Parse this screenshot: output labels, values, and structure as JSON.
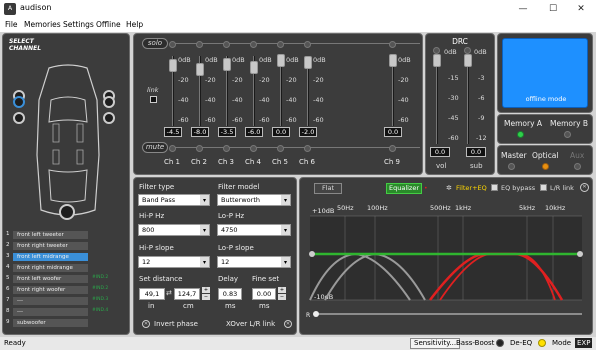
{
  "app": {
    "title": "audison",
    "logo": "A"
  },
  "window": {
    "minimize": "—",
    "maximize": "☐",
    "close": "✕"
  },
  "menu": [
    "File",
    "Memories",
    "Settings",
    "Offline",
    "Help"
  ],
  "select_channel": {
    "line1": "SELECT",
    "line2": "CHANNEL"
  },
  "channels": [
    {
      "num": "1",
      "name": "front left tweeter",
      "tag": "",
      "selected": false
    },
    {
      "num": "2",
      "name": "front right tweeter",
      "tag": "",
      "selected": false
    },
    {
      "num": "3",
      "name": "front left midrange",
      "tag": "",
      "selected": true
    },
    {
      "num": "4",
      "name": "front right midrange",
      "tag": "",
      "selected": false
    },
    {
      "num": "5",
      "name": "front left woofer",
      "tag": "#IND.2",
      "selected": false
    },
    {
      "num": "6",
      "name": "front right woofer",
      "tag": "#IND.2",
      "selected": false
    },
    {
      "num": "7",
      "name": "---",
      "tag": "#IND.3",
      "selected": false
    },
    {
      "num": "8",
      "name": "---",
      "tag": "#IND.4",
      "selected": false
    },
    {
      "num": "9",
      "name": "subwoofer",
      "tag": "",
      "selected": false
    }
  ],
  "mixer": {
    "solo": "solo",
    "mute": "mute",
    "link": "link",
    "scale": [
      "0dB",
      "-20",
      "-40",
      "-60"
    ],
    "faders": [
      {
        "label": "Ch 1",
        "value": "-4.5",
        "level": 0.075
      },
      {
        "label": "Ch 2",
        "value": "-8.0",
        "level": 0.133
      },
      {
        "label": "Ch 3",
        "value": "-3.5",
        "level": 0.058
      },
      {
        "label": "Ch 4",
        "value": "-6.0",
        "level": 0.1
      },
      {
        "label": "Ch 5",
        "value": "0.0",
        "level": 0.0
      },
      {
        "label": "Ch 6",
        "value": "-2.0",
        "level": 0.033
      },
      {
        "label": "Ch 9",
        "value": "0.0",
        "level": 0.0
      }
    ]
  },
  "drc": {
    "title": "DRC",
    "vol_label": "vol",
    "sub_label": "sub",
    "vol_scale": [
      "0dB",
      "-15",
      "-30",
      "-45",
      "-60"
    ],
    "sub_scale": [
      "0dB",
      "-3",
      "-6",
      "-9",
      "-12"
    ],
    "vol_value": "0.0",
    "sub_value": "0.0"
  },
  "offline_mode": "offline mode",
  "memory": {
    "a": "Memory A",
    "b": "Memory B"
  },
  "inputs": {
    "master": "Master",
    "optical": "Optical",
    "aux": "Aux"
  },
  "filter": {
    "type_label": "Filter type",
    "type_value": "Band Pass",
    "model_label": "Filter model",
    "model_value": "Butterworth",
    "hip_hz_label": "Hi-P Hz",
    "hip_hz_value": "800",
    "lop_hz_label": "Lo-P Hz",
    "lop_hz_value": "4750",
    "hip_slope_label": "Hi-P slope",
    "hip_slope_value": "12",
    "lop_slope_label": "Lo-P slope",
    "lop_slope_value": "12",
    "distance_label": "Set distance",
    "distance_in": "49,1",
    "distance_cm": "124,7",
    "unit_in": "in",
    "unit_cm": "cm",
    "delay_label": "Delay",
    "delay_value": "0.83",
    "delay_unit": "ms",
    "fineset_label": "Fine set",
    "fineset_value": "0.00",
    "fineset_unit": "ms",
    "invert_phase": "Invert phase",
    "xover_link": "XOver L/R link"
  },
  "eq": {
    "flat": "Flat",
    "equalizer": "Equalizer",
    "filter_eq": "Filter+EQ",
    "eq_bypass": "EQ bypass",
    "lr_link": "L/R link",
    "db_top": "+10dB",
    "db_bottom": "-10dB",
    "freqs": [
      "50Hz",
      "100Hz",
      "500Hz",
      "1kHz",
      "5kHz",
      "10kHz"
    ],
    "lr_label": "R",
    "colors": {
      "green": "#2fb52f",
      "red": "#e02020",
      "grey": "#9a9a9a"
    }
  },
  "status": {
    "left": "Ready",
    "sensitivity": "Sensitivity...",
    "bass_boost": "Bass-Boost",
    "de_eq": "De-EQ",
    "mode": "Mode",
    "exp": "EXP"
  }
}
